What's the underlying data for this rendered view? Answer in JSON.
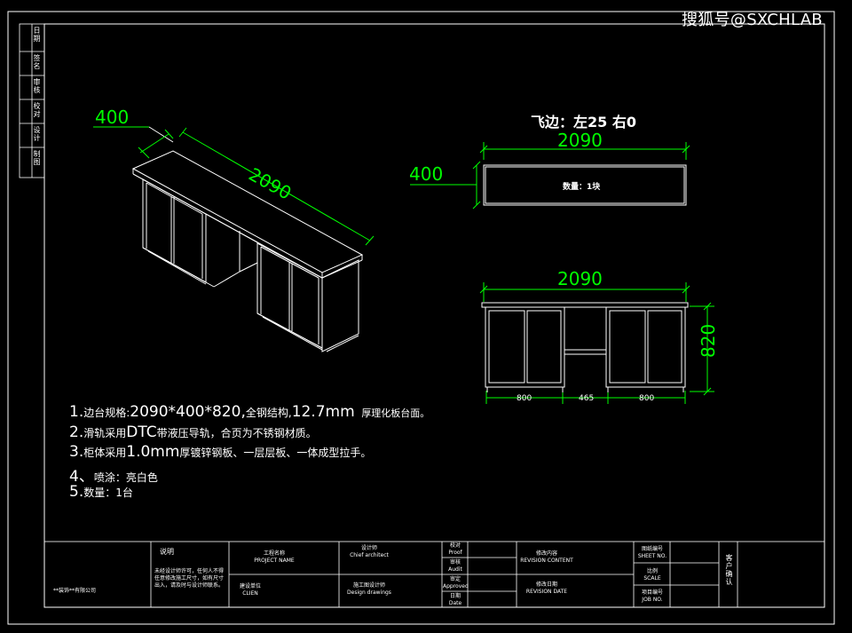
{
  "watermark": "搜狐号@SXCHLAB",
  "dims": {
    "depth": "400",
    "length": "2090",
    "height": "820",
    "bottom_left": "800",
    "bottom_mid": "465",
    "bottom_right": "800"
  },
  "top_view": {
    "label": "飞边：左25 右0",
    "qty": "数量：1块"
  },
  "notes": [
    {
      "num": "1.",
      "a": "边台规格:",
      "b": "2090*400*820,",
      "c": "全钢结构,",
      "d": "12.7mm",
      "e": "厚理化板台面。"
    },
    {
      "num": "2.",
      "a": "滑轨采用",
      "b": "DTC",
      "c": "带液压导轨，合页为不锈钢材质。"
    },
    {
      "num": "3.",
      "a": "柜体采用",
      "b": "1.0mm",
      "c": "厚镀锌钢板、一层层板、一体成型拉手。"
    },
    {
      "num": "4、",
      "a": "喷涂：亮白色"
    },
    {
      "num": "5.",
      "a": "数量：1台"
    }
  ],
  "title_block": {
    "company": "**装饰**有限公司",
    "remark_title": "说明",
    "remark_body": "未经设计师许可，任何人不得任意修改施工尺寸，如有尺寸出入，请及时与设计师联系。",
    "project_name": "工程名称\nPROJECT NAME",
    "client": "建设单位\nCLIEN",
    "chief": "设计师\nChief architect",
    "design_drawings": "施工图设计师\nDesign drawings",
    "proof": "校对\nProof",
    "audit": "审核\nAudit",
    "approved": "审定\nApproved",
    "date": "日期\nDate",
    "revision_content": "修改内容\nREVISION CONTENT",
    "revision_date": "修改日期\nREVISION DATE",
    "sheet_no": "图纸编号\nSHEET NO.",
    "scale": "比例\nSCALE",
    "job_no": "项目编号\nJOB NO.",
    "client_confirm": "客户确认"
  },
  "side_strip": [
    "日期",
    "签名",
    "审核",
    "校对",
    "设计",
    "制图"
  ]
}
